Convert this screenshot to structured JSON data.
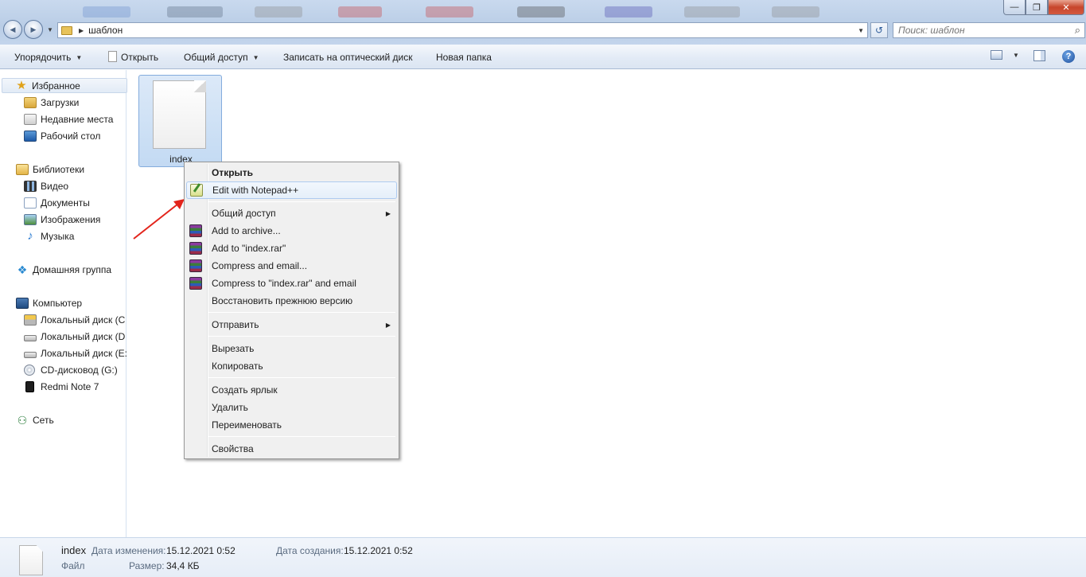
{
  "window": {
    "minimize_glyph": "—",
    "restore_glyph": "❐",
    "close_glyph": "✕"
  },
  "address": {
    "path": "шаблон",
    "back_glyph": "◀",
    "forward_glyph": "▶",
    "refresh_glyph": "↺"
  },
  "search": {
    "placeholder": "Поиск: шаблон",
    "icon": "search-icon"
  },
  "toolbar": {
    "organize": "Упорядочить",
    "open": "Открыть",
    "share": "Общий доступ",
    "burn": "Записать на оптический диск",
    "new_folder": "Новая папка",
    "help": "?"
  },
  "sidebar": {
    "favorites": "Избранное",
    "downloads": "Загрузки",
    "recent": "Недавние места",
    "desktop": "Рабочий стол",
    "libraries": "Библиотеки",
    "video": "Видео",
    "documents": "Документы",
    "images": "Изображения",
    "music": "Музыка",
    "homegroup": "Домашняя группа",
    "computer": "Компьютер",
    "disk_c": "Локальный диск (C",
    "disk_d": "Локальный диск (D",
    "disk_e": "Локальный диск (E:",
    "cd": "CD-дисковод (G:)",
    "phone": "Redmi Note 7",
    "network": "Сеть"
  },
  "file": {
    "name": "index"
  },
  "context_menu": {
    "items": [
      {
        "label": "Открыть"
      },
      {
        "label": "Edit with Notepad++"
      },
      {
        "label": "Общий доступ"
      },
      {
        "label": "Add to archive..."
      },
      {
        "label": "Add to \"index.rar\""
      },
      {
        "label": "Compress and email..."
      },
      {
        "label": "Compress to \"index.rar\" and email"
      },
      {
        "label": "Восстановить прежнюю версию"
      },
      {
        "label": "Отправить"
      },
      {
        "label": "Вырезать"
      },
      {
        "label": "Копировать"
      },
      {
        "label": "Создать ярлык"
      },
      {
        "label": "Удалить"
      },
      {
        "label": "Переименовать"
      },
      {
        "label": "Свойства"
      }
    ],
    "submenu_glyph": "▶"
  },
  "details": {
    "name": "index",
    "type": "Файл",
    "modified_label": "Дата изменения:",
    "modified_value": "15.12.2021 0:52",
    "created_label": "Дата создания:",
    "created_value": "15.12.2021 0:52",
    "size_label": "Размер:",
    "size_value": "34,4 КБ"
  },
  "colors": {
    "annotation_arrow": "#e3241b",
    "selection": "#c3daf3",
    "menu_hover_border": "#aecbf0"
  }
}
